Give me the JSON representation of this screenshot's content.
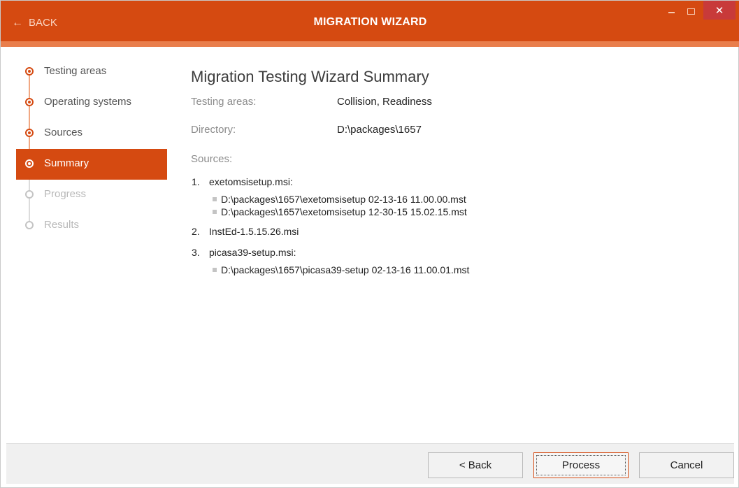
{
  "window": {
    "title": "MIGRATION WIZARD",
    "back_label": "BACK",
    "close_glyph": "✕",
    "accent_color": "#d54a11"
  },
  "steps": [
    {
      "label": "Testing areas",
      "state": "done"
    },
    {
      "label": "Operating systems",
      "state": "done"
    },
    {
      "label": "Sources",
      "state": "done"
    },
    {
      "label": "Summary",
      "state": "active"
    },
    {
      "label": "Progress",
      "state": "disabled"
    },
    {
      "label": "Results",
      "state": "disabled"
    }
  ],
  "summary": {
    "title": "Migration Testing Wizard Summary",
    "testing_areas_label": "Testing areas:",
    "testing_areas_value": "Collision, Readiness",
    "directory_label": "Directory:",
    "directory_value": "D:\\packages\\1657",
    "sources_label": "Sources:",
    "sources": [
      {
        "num": "1.",
        "name": "exetomsisetup.msi:",
        "transforms": [
          "D:\\packages\\1657\\exetomsisetup 02-13-16 11.00.00.mst",
          "D:\\packages\\1657\\exetomsisetup 12-30-15 15.02.15.mst"
        ]
      },
      {
        "num": "2.",
        "name": "InstEd-1.5.15.26.msi",
        "transforms": []
      },
      {
        "num": "3.",
        "name": "picasa39-setup.msi:",
        "transforms": [
          "D:\\packages\\1657\\picasa39-setup 02-13-16 11.00.01.mst"
        ]
      }
    ]
  },
  "footer": {
    "back_label": "< Back",
    "process_label": "Process",
    "cancel_label": "Cancel"
  }
}
